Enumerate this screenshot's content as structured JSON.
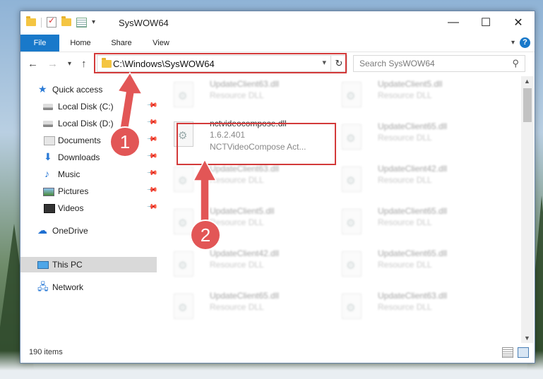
{
  "window": {
    "title": "SysWOW64"
  },
  "ribbon": {
    "tabs": [
      "File",
      "Home",
      "Share",
      "View"
    ]
  },
  "address": {
    "path": "C:\\Windows\\SysWOW64"
  },
  "search": {
    "placeholder": "Search SysWOW64"
  },
  "sidebar": {
    "items": [
      {
        "label": "Quick access"
      },
      {
        "label": "Local Disk (C:)"
      },
      {
        "label": "Local Disk (D:)"
      },
      {
        "label": "Documents"
      },
      {
        "label": "Downloads"
      },
      {
        "label": "Music"
      },
      {
        "label": "Pictures"
      },
      {
        "label": "Videos"
      },
      {
        "label": "OneDrive"
      },
      {
        "label": "This PC"
      },
      {
        "label": "Network"
      }
    ]
  },
  "files": {
    "selected": {
      "name": "nctvideocompose.dll",
      "version": "1.6.2.401",
      "description": "NCTVideoCompose Act..."
    },
    "others": [
      {
        "name": "UpdateClient63.dll",
        "type": "Resource DLL"
      },
      {
        "name": "UpdateClient5.dll",
        "type": "Resource DLL"
      },
      {
        "name": "UpdateClient65.dll",
        "type": "Resource DLL"
      },
      {
        "name": "UpdateClient63.dll",
        "type": "Resource DLL"
      },
      {
        "name": "UpdateClient42.dll",
        "type": "Resource DLL"
      },
      {
        "name": "UpdateClient5.dll",
        "type": "Resource DLL"
      },
      {
        "name": "UpdateClient65.dll",
        "type": "Resource DLL"
      },
      {
        "name": "UpdateClient42.dll",
        "type": "Resource DLL"
      },
      {
        "name": "UpdateClient65.dll",
        "type": "Resource DLL"
      },
      {
        "name": "UpdateClient65.dll",
        "type": "Resource DLL"
      },
      {
        "name": "UpdateClient63.dll",
        "type": "Resource DLL"
      }
    ]
  },
  "status": {
    "count": "190 items"
  },
  "callouts": [
    "1",
    "2"
  ],
  "colors": {
    "accent": "#1979ca",
    "highlight": "#d33a3a",
    "callout": "#e25656"
  }
}
